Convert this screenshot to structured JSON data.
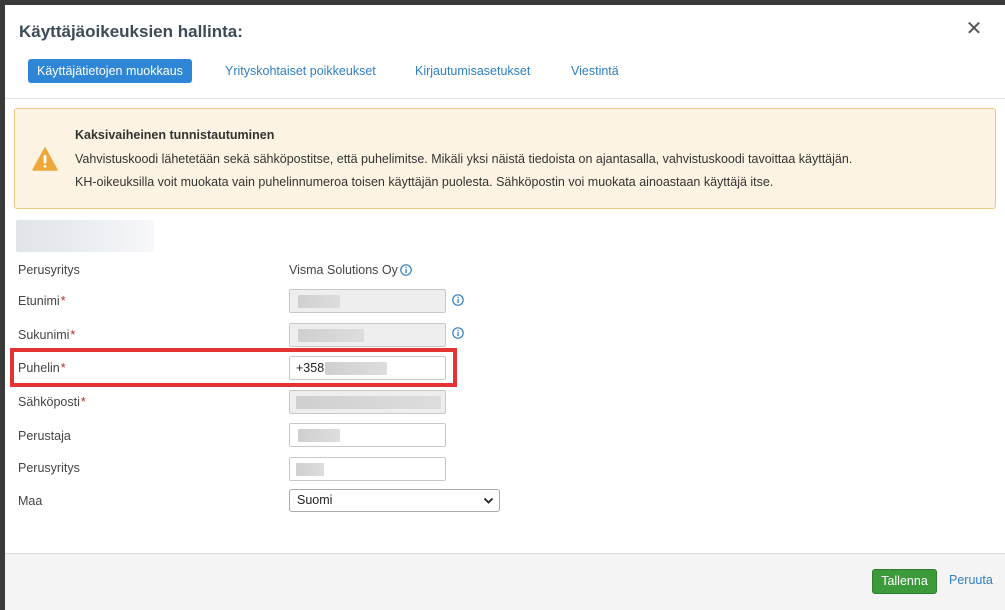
{
  "dialog": {
    "title": "Käyttäjäoikeuksien hallinta:",
    "close_label": "✕"
  },
  "tabs": [
    {
      "label": "Käyttäjätietojen muokkaus",
      "active": true
    },
    {
      "label": "Yrityskohtaiset poikkeukset",
      "active": false
    },
    {
      "label": "Kirjautumisasetukset",
      "active": false
    },
    {
      "label": "Viestintä",
      "active": false
    }
  ],
  "alert": {
    "title": "Kaksivaiheinen tunnistautuminen",
    "line1": "Vahvistuskoodi lähetetään sekä sähköpostitse, että puhelimitse. Mikäli yksi näistä tiedoista on ajantasalla, vahvistuskoodi tavoittaa käyttäjän.",
    "line2": "KH-oikeuksilla voit muokata vain puhelinnumeroa toisen käyttäjän puolesta. Sähköpostin voi muokata ainoastaan käyttäjä itse."
  },
  "form": {
    "required_mark": "*",
    "perusyritys_label": "Perusyritys",
    "perusyritys_value": "Visma Solutions Oy",
    "etunimi_label": "Etunimi",
    "sukunimi_label": "Sukunimi",
    "puhelin_label": "Puhelin",
    "puhelin_value": "+358",
    "sahkoposti_label": "Sähköposti",
    "perustaja_label": "Perustaja",
    "perusyritys2_label": "Perusyritys",
    "maa_label": "Maa",
    "maa_value": "Suomi"
  },
  "footer": {
    "save_label": "Tallenna",
    "cancel_label": "Peruuta"
  },
  "colors": {
    "primary": "#2f86d6",
    "save_green": "#3c9a3a",
    "alert_bg": "#fdf3e2",
    "alert_border": "#efc886",
    "warning_icon": "#f0a73a",
    "highlight_red": "#e53232",
    "required_red": "#c0282a"
  }
}
